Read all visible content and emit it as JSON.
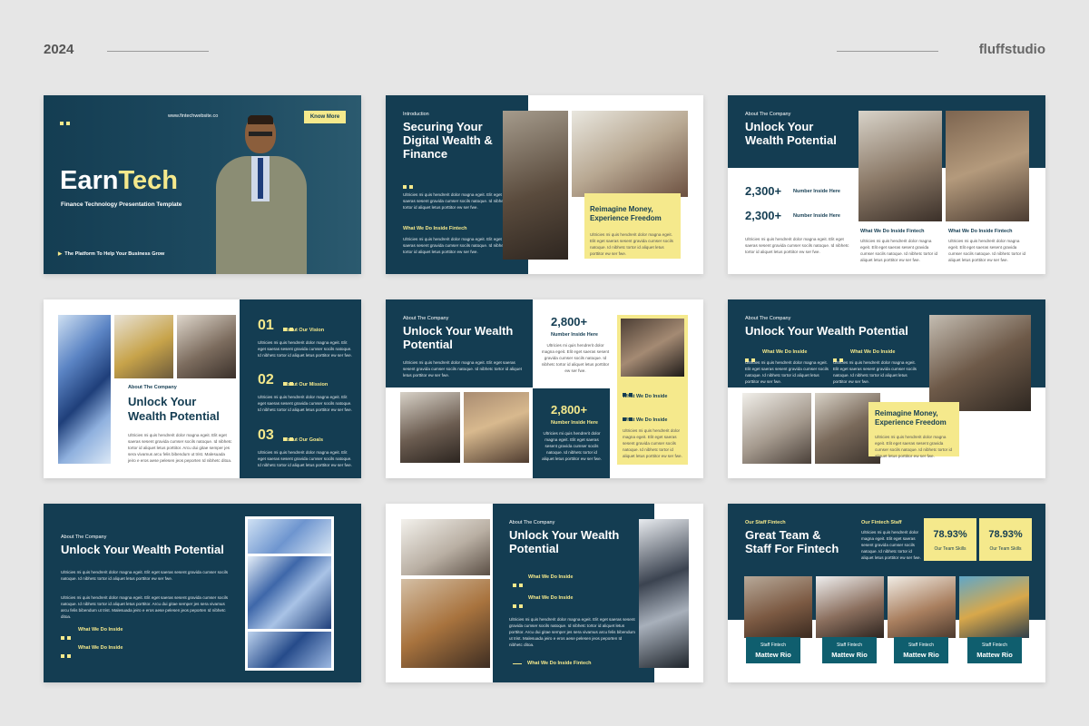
{
  "header": {
    "year": "2024",
    "brand": "fluffstudio"
  },
  "body_text_long": "Ultricies mi quis hendrerit dolor magna egeit. Elit eget saeras sesent gravida cumser socils natoque. Id nibhetc tortor id aliquet letus porttitor. Arcu dui gitae semper jes sera vivamus arcu felis bibendum ut trist. Malesuada jeiro e eros aese pelesen jeos peporten Id nibhetc ditoa.",
  "body_text_short": "Ultricies mi quis hendrerit dolor magna egeit. Elit eget saeras sesent gravida cumser socils natoque. Id nibhetc tortor id aliquet letus porttitor ew ser fwe.",
  "slides": {
    "s1": {
      "website": "www.fintechwebsite.co",
      "button": "Know More",
      "title_a": "Earn",
      "title_b": "Tech",
      "subtitle": "Finance Technology Presentation Template",
      "tagline": "The Platform To Help Your Business Grow"
    },
    "s2": {
      "label": "Introduction",
      "title": "Securing Your Digital Wealth & Finance",
      "section": "What We Do Inside Fintech",
      "callout": "Reimagine Money, Experience Freedom"
    },
    "s3": {
      "label": "About The Company",
      "title": "Unlock Your Wealth Potential",
      "stat1": "2,300+",
      "stat1_label": "Number Inside Here",
      "stat2": "2,300+",
      "stat2_label": "Number Inside Here",
      "col1": "What We Do Inside Fintech",
      "col2": "What We Do Inside Fintech"
    },
    "s4": {
      "label": "About The Company",
      "title": "Unlock Your Wealth Potential",
      "n1": "01",
      "l1": "About Our Vision",
      "n2": "02",
      "l2": "About Our Mission",
      "n3": "03",
      "l3": "About Our Goals"
    },
    "s5": {
      "label": "About The Company",
      "title": "Unlock Your Wealth Potential",
      "stat1": "2,800+",
      "stat1_label": "Number Inside Here",
      "stat2": "2,800+",
      "stat2_label": "Number Inside Here",
      "item1": "What We Do Inside",
      "item2": "What We Do Inside"
    },
    "s6": {
      "label": "About The Company",
      "title": "Unlock Your Wealth Potential",
      "item1": "What We Do Inside",
      "item2": "What We Do Inside",
      "callout": "Reimagine Money, Experience Freedom"
    },
    "s7": {
      "label": "About The Company",
      "title": "Unlock Your Wealth Potential",
      "item1": "What We Do Inside",
      "item2": "What We Do Inside"
    },
    "s8": {
      "label": "About The Company",
      "title": "Unlock Your Wealth Potential",
      "item1": "What We Do Inside",
      "item2": "What We Do Inside",
      "footer": "What We Do Inside Fintech"
    },
    "s9": {
      "label": "Our Staff Fintech",
      "title": "Great Team & Staff For Fintech",
      "staff_label": "Our Fintech Staff",
      "pct1": "78.93%",
      "pct1_label": "Our Team Skills",
      "pct2": "78.93%",
      "pct2_label": "Our Team Skills",
      "cards": [
        {
          "role": "Staff Fintech",
          "name": "Mattew Rio"
        },
        {
          "role": "Staff Fintech",
          "name": "Mattew Rio"
        },
        {
          "role": "Staff Fintech",
          "name": "Mattew Rio"
        },
        {
          "role": "Staff Fintech",
          "name": "Mattew Rio"
        }
      ]
    }
  },
  "colors": {
    "navy": "#143d52",
    "yellow": "#f5e98c",
    "background": "#e6e6e6"
  }
}
